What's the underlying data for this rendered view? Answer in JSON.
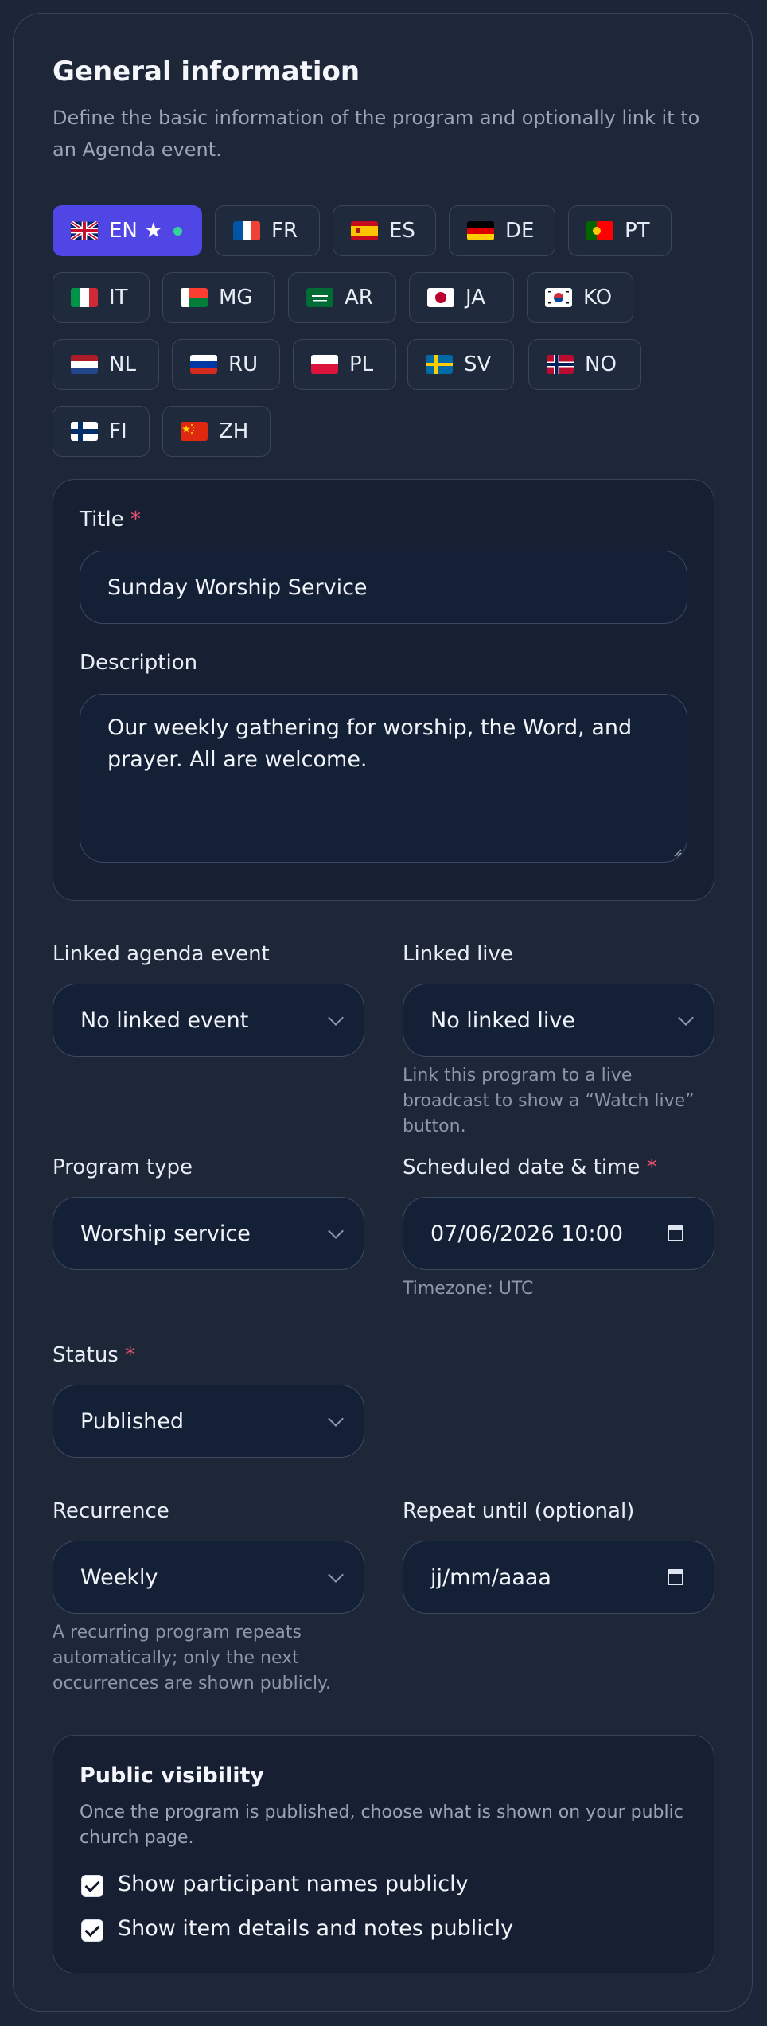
{
  "section": {
    "title": "General information",
    "subtitle": "Define the basic information of the program and optionally link it to an Agenda event."
  },
  "languages": [
    {
      "code": "EN ★",
      "flag": "uk-flag-icon",
      "active": true
    },
    {
      "code": "FR",
      "flag": "france-flag-icon"
    },
    {
      "code": "ES",
      "flag": "spain-flag-icon"
    },
    {
      "code": "DE",
      "flag": "germany-flag-icon"
    },
    {
      "code": "PT",
      "flag": "portugal-flag-icon"
    },
    {
      "code": "IT",
      "flag": "italy-flag-icon"
    },
    {
      "code": "MG",
      "flag": "madagascar-flag-icon"
    },
    {
      "code": "AR",
      "flag": "saudi-flag-icon"
    },
    {
      "code": "JA",
      "flag": "japan-flag-icon"
    },
    {
      "code": "KO",
      "flag": "korea-flag-icon"
    },
    {
      "code": "NL",
      "flag": "netherlands-flag-icon"
    },
    {
      "code": "RU",
      "flag": "russia-flag-icon"
    },
    {
      "code": "PL",
      "flag": "poland-flag-icon"
    },
    {
      "code": "SV",
      "flag": "sweden-flag-icon"
    },
    {
      "code": "NO",
      "flag": "norway-flag-icon"
    },
    {
      "code": "FI",
      "flag": "finland-flag-icon"
    },
    {
      "code": "ZH",
      "flag": "china-flag-icon"
    }
  ],
  "translation": {
    "title_label": "Title",
    "title_value": "Sunday Worship Service",
    "description_label": "Description",
    "description_value": "Our weekly gathering for worship, the Word, and prayer. All are welcome."
  },
  "required_mark": "*",
  "fields": {
    "linked_agenda_label": "Linked agenda event",
    "linked_agenda_value": "No linked event",
    "linked_live_label": "Linked live",
    "linked_live_value": "No linked live",
    "linked_live_help": "Link this program to a live broadcast to show a “Watch live” button.",
    "program_type_label": "Program type",
    "program_type_value": "Worship service",
    "scheduled_label": "Scheduled date & time",
    "scheduled_value": "07/06/2026 10:00",
    "timezone_help": "Timezone: UTC",
    "status_label": "Status",
    "status_value": "Published",
    "recurrence_label": "Recurrence",
    "recurrence_value": "Weekly",
    "recurrence_help": "A recurring program repeats automatically; only the next occurrences are shown publicly.",
    "repeat_until_label": "Repeat until (optional)",
    "repeat_until_placeholder": "jj/mm/aaaa"
  },
  "visibility": {
    "title": "Public visibility",
    "description": "Once the program is published, choose what is shown on your public church page.",
    "show_names_label": "Show participant names publicly",
    "show_names_checked": true,
    "show_details_label": "Show item details and notes publicly",
    "show_details_checked": true
  },
  "colors": {
    "accent": "#4f46e5",
    "active_dot": "#34d399",
    "required": "#f0506e"
  }
}
